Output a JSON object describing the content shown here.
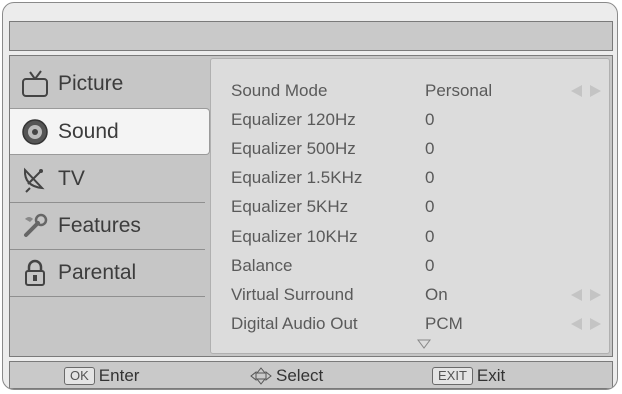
{
  "sidebar": {
    "items": [
      {
        "label": "Picture",
        "icon": "tv-icon"
      },
      {
        "label": "Sound",
        "icon": "speaker-icon"
      },
      {
        "label": "TV",
        "icon": "satellite-dish-icon"
      },
      {
        "label": "Features",
        "icon": "tools-icon"
      },
      {
        "label": "Parental",
        "icon": "lock-icon"
      }
    ],
    "active_index": 1
  },
  "settings": [
    {
      "label": "Sound Mode",
      "value": "Personal",
      "adjustable": true
    },
    {
      "label": "Equalizer 120Hz",
      "value": "0",
      "adjustable": false
    },
    {
      "label": "Equalizer 500Hz",
      "value": "0",
      "adjustable": false
    },
    {
      "label": "Equalizer 1.5KHz",
      "value": "0",
      "adjustable": false
    },
    {
      "label": "Equalizer 5KHz",
      "value": "0",
      "adjustable": false
    },
    {
      "label": "Equalizer 10KHz",
      "value": "0",
      "adjustable": false
    },
    {
      "label": "Balance",
      "value": "0",
      "adjustable": false
    },
    {
      "label": "Virtual Surround",
      "value": "On",
      "adjustable": true
    },
    {
      "label": "Digital Audio Out",
      "value": "PCM",
      "adjustable": true
    }
  ],
  "footer": {
    "enter_key": "OK",
    "enter_label": "Enter",
    "select_label": "Select",
    "exit_key": "EXIT",
    "exit_label": "Exit"
  },
  "colors": {
    "panel_bg": "#c6c6c6",
    "content_bg": "#dcdcdc",
    "active_item_bg": "#f4f4f4",
    "text": "#5a5a5a"
  }
}
